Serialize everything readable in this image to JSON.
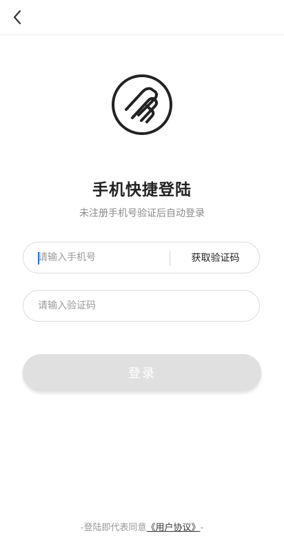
{
  "header": {
    "back_icon": "chevron-left-icon"
  },
  "logo": {
    "icon": "brand-logo-icon",
    "color": "#222222"
  },
  "title": "手机快捷登陆",
  "subtitle": "未注册手机号验证后自动登录",
  "phone_field": {
    "placeholder": "请输入手机号",
    "value": ""
  },
  "get_code_label": "获取验证码",
  "code_field": {
    "placeholder": "请输入验证码",
    "value": ""
  },
  "login_button": {
    "label": "登录",
    "disabled_color": "#e0e0e0"
  },
  "agreement": {
    "prefix": "-登陆即代表同意",
    "link": "《用户协议》",
    "suffix": "-"
  },
  "colors": {
    "caret": "#1a73e8"
  }
}
